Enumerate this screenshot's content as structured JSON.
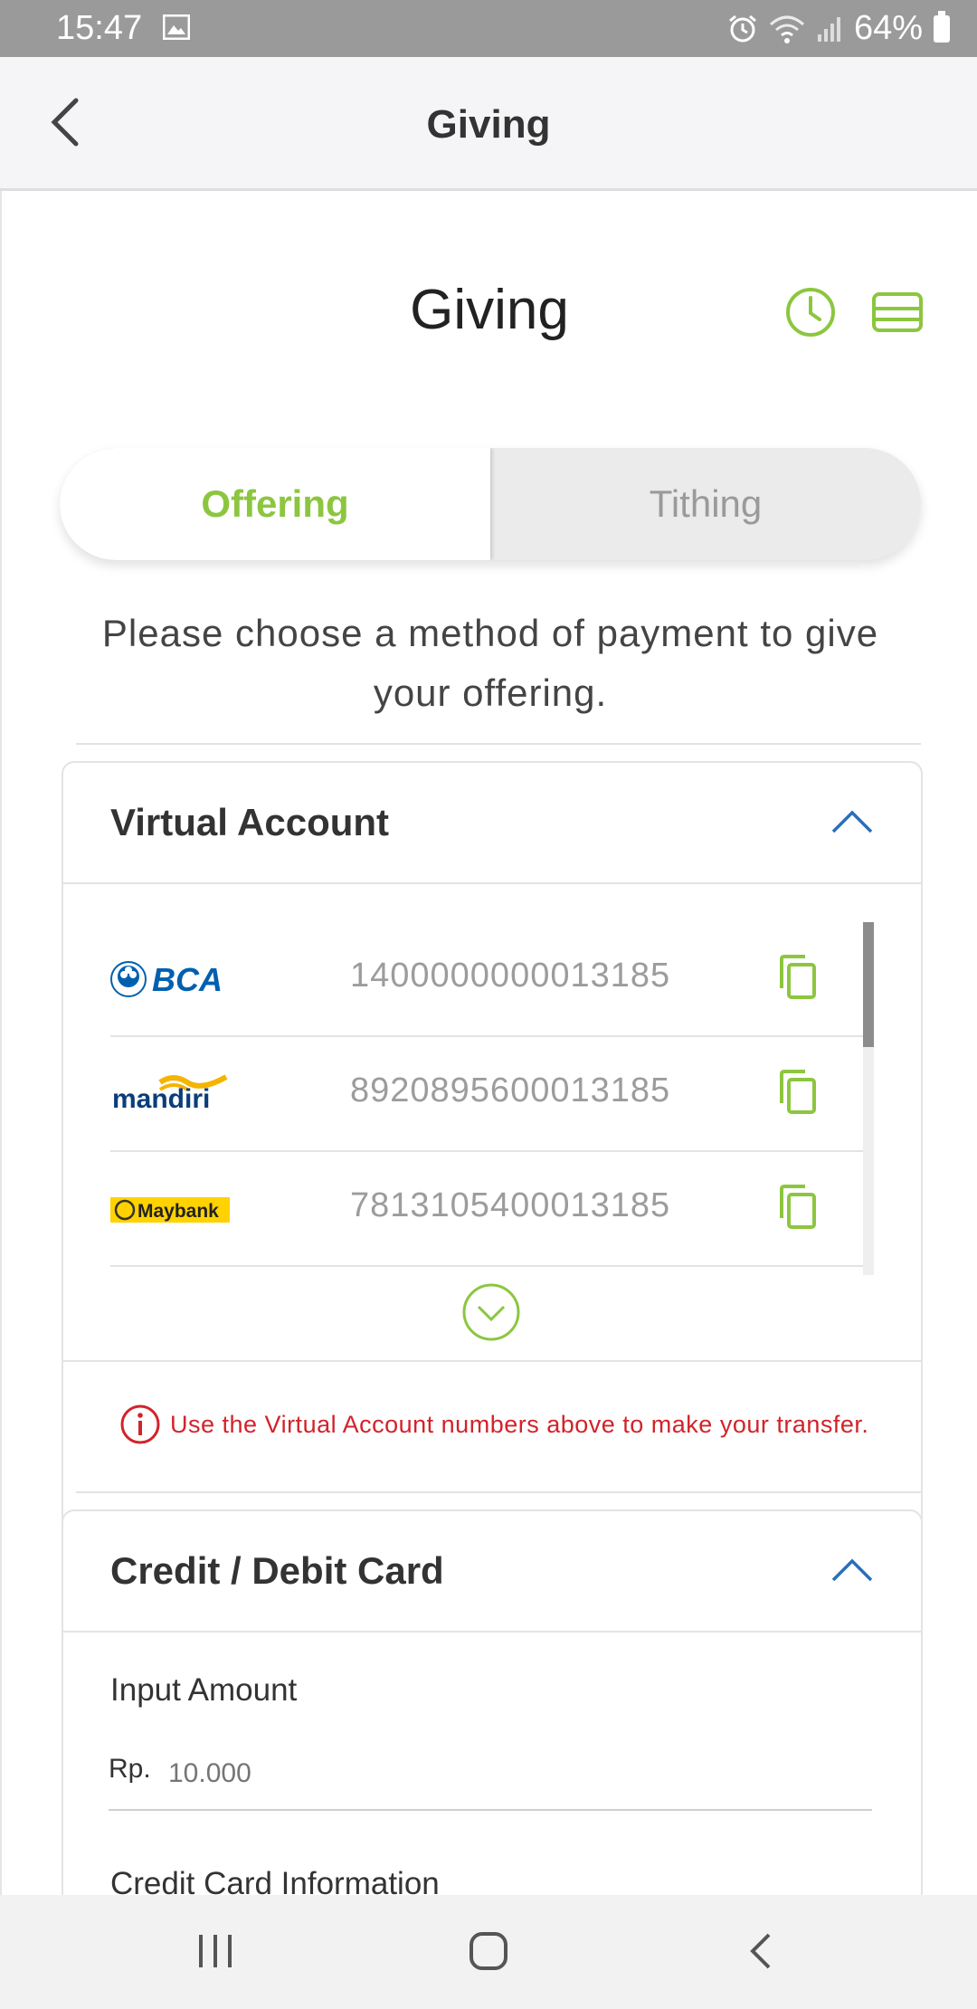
{
  "status_bar": {
    "time": "15:47",
    "battery": "64%"
  },
  "app_bar": {
    "title": "Giving"
  },
  "page": {
    "title": "Giving",
    "accent_color": "#8cc63f"
  },
  "tabs": [
    {
      "label": "Offering",
      "selected": true
    },
    {
      "label": "Tithing",
      "selected": false
    }
  ],
  "instruction": "Please choose a method of payment to give your offering.",
  "virtual_account": {
    "title": "Virtual Account",
    "banks": [
      {
        "name": "BCA",
        "number": "1400000000013185"
      },
      {
        "name": "mandiri",
        "number": "8920895600013185"
      },
      {
        "name": "Maybank",
        "number": "7813105400013185"
      }
    ],
    "notice": "Use the Virtual Account numbers above to make your transfer."
  },
  "card_payment": {
    "title": "Credit / Debit Card",
    "amount_label": "Input Amount",
    "currency": "Rp.",
    "amount_placeholder": "10.000",
    "card_info_label": "Credit Card Information"
  }
}
